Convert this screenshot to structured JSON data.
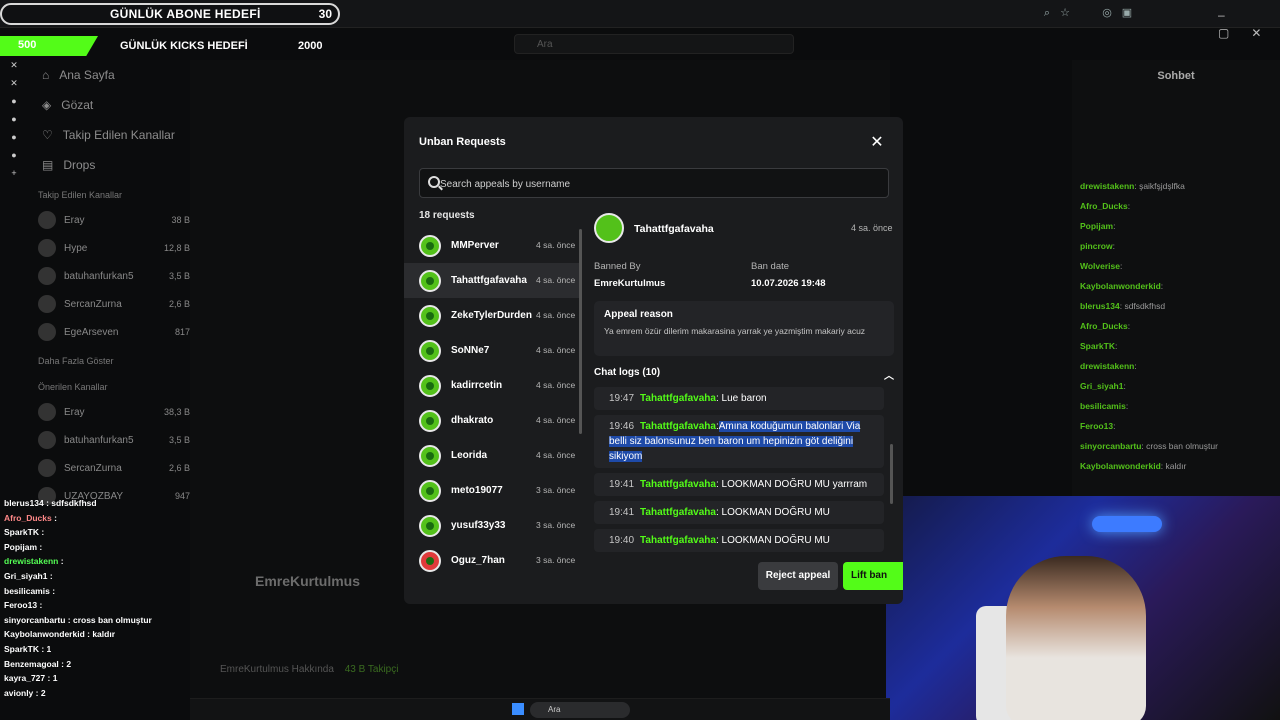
{
  "browser": {
    "abone_goal_label": "GÜNLÜK ABONE HEDEFİ",
    "abone_goal_value": "30",
    "kicks_current": "500",
    "kicks_label": "GÜNLÜK KICKS HEDEFİ",
    "kicks_goal": "2000",
    "search_placeholder": "Ara"
  },
  "sidebar": {
    "nav": [
      {
        "label": "Ana Sayfa",
        "icon": "home-icon"
      },
      {
        "label": "Gözat",
        "icon": "compass-icon"
      },
      {
        "label": "Takip Edilen Kanallar",
        "icon": "heart-icon"
      },
      {
        "label": "Drops",
        "icon": "gift-icon"
      }
    ],
    "following_title": "Takip Edilen Kanallar",
    "following": [
      {
        "name": "Eray",
        "viewers": "38 B"
      },
      {
        "name": "Hype",
        "viewers": "12,8 B"
      },
      {
        "name": "batuhanfurkan5",
        "viewers": "3,5 B"
      },
      {
        "name": "SercanZurna",
        "viewers": "2,6 B"
      },
      {
        "name": "EgeArseven",
        "viewers": "817"
      }
    ],
    "show_more": "Daha Fazla Göster",
    "recommended_title": "Önerilen Kanallar",
    "recommended": [
      {
        "name": "Eray",
        "viewers": "38,3 B"
      },
      {
        "name": "batuhanfurkan5",
        "viewers": "3,5 B"
      },
      {
        "name": "SercanZurna",
        "viewers": "2,6 B"
      },
      {
        "name": "UZAYOZBAY",
        "viewers": "947"
      }
    ]
  },
  "background_profile": {
    "name": "EmreKurtulmus",
    "about": "EmreKurtulmus Hakkında",
    "followers": "43 B Takipçi"
  },
  "right_chat": {
    "title": "Sohbet",
    "messages": [
      {
        "user": "drewistakenn",
        "text": "şaikfşjdşlfka"
      },
      {
        "user": "Afro_Ducks",
        "text": ""
      },
      {
        "user": "Popijam",
        "text": ""
      },
      {
        "user": "pincrow",
        "text": ""
      },
      {
        "user": "Wolverise",
        "text": ""
      },
      {
        "user": "Kaybolanwonderkid",
        "text": ""
      },
      {
        "user": "blerus134",
        "text": "sdfsdkfhsd"
      },
      {
        "user": "Afro_Ducks",
        "text": ""
      },
      {
        "user": "SparkTK",
        "text": ""
      },
      {
        "user": "drewistakenn",
        "text": ""
      },
      {
        "user": "Gri_siyah1",
        "text": ""
      },
      {
        "user": "besilicamis",
        "text": ""
      },
      {
        "user": "Feroo13",
        "text": ""
      },
      {
        "user": "sinyorcanbartu",
        "text": "cross ban olmuştur"
      },
      {
        "user": "Kaybolanwonderkid",
        "text": "kaldır"
      }
    ]
  },
  "left_chat": [
    {
      "user": "blerus134",
      "text": "sdfsdkfhsd"
    },
    {
      "user": "Afro_Ducks",
      "text": ""
    },
    {
      "user": "SparkTK",
      "text": ""
    },
    {
      "user": "Popijam",
      "text": ""
    },
    {
      "user": "drewistakenn",
      "text": ""
    },
    {
      "user": "Gri_siyah1",
      "text": ""
    },
    {
      "user": "besilicamis",
      "text": ""
    },
    {
      "user": "Feroo13",
      "text": ""
    },
    {
      "user": "sinyorcanbartu",
      "text": "cross ban olmuştur"
    },
    {
      "user": "Kaybolanwonderkid",
      "text": "kaldır"
    },
    {
      "user": "SparkTK",
      "text": "1"
    },
    {
      "user": "Benzemagoal",
      "text": "2"
    },
    {
      "user": "kayra_727",
      "text": "1"
    },
    {
      "user": "avionly",
      "text": "2"
    }
  ],
  "taskbar": {
    "search": "Ara"
  },
  "modal": {
    "title": "Unban Requests",
    "search_placeholder": "Search appeals by username",
    "count_label": "18 requests",
    "requests": [
      {
        "name": "MMPerver",
        "time": "4 sa. önce"
      },
      {
        "name": "Tahattfgafavaha",
        "time": "4 sa. önce"
      },
      {
        "name": "ZekeTylerDurden",
        "time": "4 sa. önce"
      },
      {
        "name": "SoNNe7",
        "time": "4 sa. önce"
      },
      {
        "name": "kadirrcetin",
        "time": "4 sa. önce"
      },
      {
        "name": "dhakrato",
        "time": "4 sa. önce"
      },
      {
        "name": "Leorida",
        "time": "4 sa. önce"
      },
      {
        "name": "meto19077",
        "time": "3 sa. önce"
      },
      {
        "name": "yusuf33y33",
        "time": "3 sa. önce"
      },
      {
        "name": "Oguz_7han",
        "time": "3 sa. önce"
      }
    ],
    "detail": {
      "name": "Tahattfgafavaha",
      "time": "4 sa. önce",
      "banned_by_label": "Banned By",
      "banned_by": "EmreKurtulmus",
      "ban_date_label": "Ban date",
      "ban_date": "10.07.2026 19:48",
      "appeal_reason_label": "Appeal reason",
      "appeal_reason": "Ya emrem özür dilerim makarasina yarrak ye yazmiştim makariy acuz",
      "chat_logs_label": "Chat logs (10)",
      "logs": [
        {
          "time": "19:47",
          "user": "Tahattfgafavaha",
          "text": "Lue baron"
        },
        {
          "time": "19:46",
          "user": "Tahattfgafavaha",
          "text": "Amına koduğumun balonlari Via belli siz balonsunuz ben baron um hepinizin göt deliğini sikiyom"
        },
        {
          "time": "19:41",
          "user": "Tahattfgafavaha",
          "text": "LOOKMAN DOĞRU MU yarrram"
        },
        {
          "time": "19:41",
          "user": "Tahattfgafavaha",
          "text": "LOOKMAN DOĞRU MU"
        },
        {
          "time": "19:40",
          "user": "Tahattfgafavaha",
          "text": "LOOKMAN DOĞRU MU"
        }
      ]
    },
    "reject_label": "Reject appeal",
    "lift_label": "Lift ban"
  },
  "colors": {
    "accent": "#53fc18",
    "modal_bg": "#1b1c1e",
    "highlight": "#1e4aa8"
  }
}
